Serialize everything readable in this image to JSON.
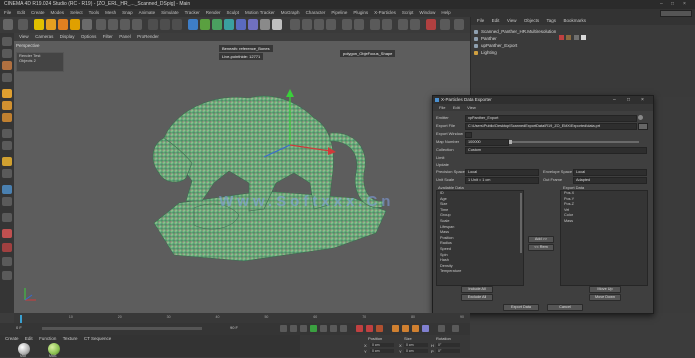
{
  "window": {
    "title": "CINEMA 4D R19.024 Studio (RC - R19) - [ZO_ERL_HR_..._Scanned_DSpig] - Main"
  },
  "menubar": {
    "items": [
      "File",
      "Edit",
      "Create",
      "Modes",
      "Select",
      "Tools",
      "Mesh",
      "Snap",
      "Animate",
      "Simulate",
      "Tracker",
      "Render",
      "Sculpt",
      "Motion Tracker",
      "MoGraph",
      "Character",
      "Pipeline",
      "Plugins",
      "X-Particles",
      "Script",
      "Window",
      "Help"
    ],
    "layout_label": "Layout:"
  },
  "viewport": {
    "menu": [
      "View",
      "Cameras",
      "Display",
      "Options",
      "Filter",
      "Panel",
      "ProRender"
    ],
    "camera_label": "Perspective",
    "render_panel": {
      "title": "Render Test",
      "row": "Objects  2"
    },
    "label_bone": "Beneath: reference_Bones",
    "label_point": "Live-pointhide: 12771",
    "label_poly": "polygon_ObjeFocus_Shape",
    "watermark": "Www.Softxxx.Cn"
  },
  "object_manager": {
    "menu": [
      "File",
      "Edit",
      "View",
      "Objects",
      "Tags",
      "Bookmarks"
    ],
    "rows": [
      {
        "label": "Scanned_Panther_HR.Multiresolution",
        "color": "#8fa0b0"
      },
      {
        "label": "Panther",
        "color": "#8fa0b0"
      },
      {
        "label": "upPanther_Export",
        "color": "#8fa0b0"
      },
      {
        "label": "Lighting",
        "color": "#d0a040"
      }
    ]
  },
  "dialog": {
    "title": "X-Particles Data Exporter",
    "menu": [
      "File",
      "Edit",
      "View"
    ],
    "fields": {
      "emitter_label": "Emitter",
      "emitter_value": "xpPanther_Export",
      "export_file_label": "Export File",
      "export_file_value": "C:\\Users\\Public\\Desktop\\ScannedExportData\\R19_ZO_EMX\\Exported\\data.prt",
      "export_window_label": "Export Window",
      "map_number_label": "Map Number",
      "map_number_value": "100000",
      "from_label": "Collection",
      "from_value": "Custom",
      "limit_label": "Limit",
      "update_label": "Update",
      "precision_label": "Precision Space",
      "precision_value": "Local",
      "envelope_label": "Envelope Space",
      "envelope_value": "Local",
      "unit_scale_label": "Unit Scale",
      "unit_scale_value": "1 Unit = 1 cm",
      "end_frame_label": "Out Frame",
      "end_frame_value": "Adapted",
      "available_label": "Available Data",
      "export_label": "Export Data"
    },
    "available_items": [
      "ID",
      "Age",
      "Size",
      "Time",
      "Group",
      "Scale",
      "Lifespan",
      "Mass",
      "Position",
      "Radius",
      "Speed",
      "Spin",
      "Hash",
      "Density",
      "Temperature"
    ],
    "export_items": [
      "Pos.X",
      "Pos.Y",
      "Pos.Z",
      "Vel",
      "Color",
      "Mass"
    ],
    "add_label": "Add >>",
    "remove_label": "<< Rem",
    "move_up_label": "Move Up",
    "move_down_label": "Move Down",
    "include_all_label": "Include All",
    "exclude_all_label": "Exclude All",
    "export_button": "Export Data",
    "cancel_button": "Cancel"
  },
  "timeline": {
    "ticks": [
      "0",
      "10",
      "20",
      "30",
      "40",
      "50",
      "60",
      "70",
      "80",
      "90"
    ],
    "frame_start": "0 F",
    "frame_end": "90 F",
    "current": "0 F"
  },
  "material_manager": {
    "menu": [
      "Create",
      "Edit",
      "Function",
      "Texture",
      "CT Sequence"
    ],
    "materials": [
      "Mat",
      "Mat1"
    ]
  },
  "coordinates": {
    "headers": [
      "Position",
      "Size",
      "Rotation"
    ],
    "rows": [
      [
        "X",
        "0 cm",
        "X",
        "0 cm",
        "H",
        "0°"
      ],
      [
        "Y",
        "0 cm",
        "Y",
        "0 cm",
        "P",
        "0°"
      ],
      [
        "Z",
        "0 cm",
        "Z",
        "0 cm",
        "B",
        "0°"
      ]
    ]
  }
}
